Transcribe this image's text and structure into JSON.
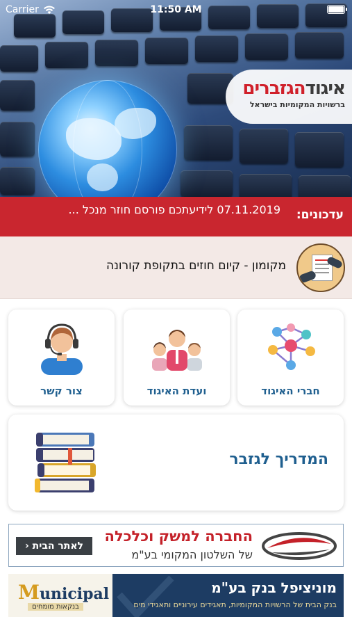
{
  "status_bar": {
    "carrier": "Carrier",
    "time": "11:50 AM",
    "wifi_icon": "wifi-icon",
    "battery_icon": "battery-icon"
  },
  "hero": {
    "logo_title_dark": "איגוד",
    "logo_title_red": "הגזברים",
    "logo_subtitle": "ברשויות המקומיות בישראל"
  },
  "ticker": {
    "label": "עדכונים:",
    "text": "07.11.2019 לידיעתכם פורסם חוזר מנכל ..."
  },
  "notice": {
    "text": "מקומון - קיום חוזים בתקופת קורונה",
    "icon": "contract-handshake-icon"
  },
  "tiles": [
    {
      "label": "חברי האיגוד",
      "icon": "network-nodes-icon"
    },
    {
      "label": "ועדת האיגוד",
      "icon": "people-group-icon"
    },
    {
      "label": "צור קשר",
      "icon": "headset-support-icon"
    }
  ],
  "guide": {
    "label": "המדריך לגזבר",
    "icon": "books-stack-icon"
  },
  "banner_economy": {
    "title": "החברה למשק וכלכלה",
    "subtitle": "של השלטון המקומי בע\"מ",
    "button": "לאתר הבית ‹"
  },
  "banner_bank": {
    "title": "מוניציפל בנק בע\"מ",
    "subtitle": "בנק הבית של הרשויות המקומיות, תאגידים עירוניים ותאגידי מים",
    "logo_text": "unicipal",
    "logo_initial": "M",
    "logo_tagline": "בנקאות מומחים"
  },
  "colors": {
    "ticker_red": "#c9262f",
    "tile_label_blue": "#1f5f8f",
    "bank_navy": "#1d3c63"
  }
}
